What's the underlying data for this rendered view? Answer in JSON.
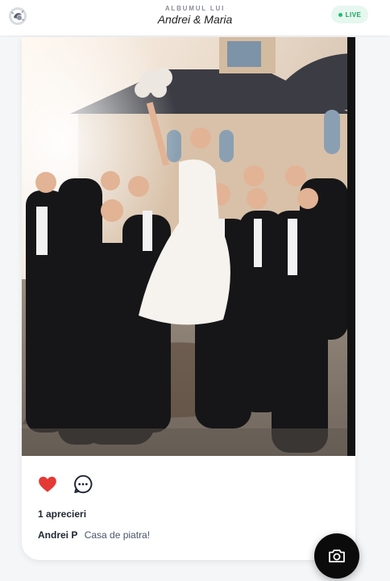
{
  "header": {
    "subtitle": "ALBUMUL LUI",
    "title": "Andrei & Maria",
    "live_label": "LIVE"
  },
  "post": {
    "likes_text": "1 aprecieri",
    "liked": true,
    "comment": {
      "author": "Andrei P",
      "text": "Casa de piatra!"
    }
  },
  "colors": {
    "like_red": "#e53935",
    "live_green": "#1fbf6b",
    "fab_black": "#0b0b0b"
  },
  "icons": [
    "logo-icon",
    "heart-icon",
    "comment-icon",
    "camera-icon"
  ]
}
